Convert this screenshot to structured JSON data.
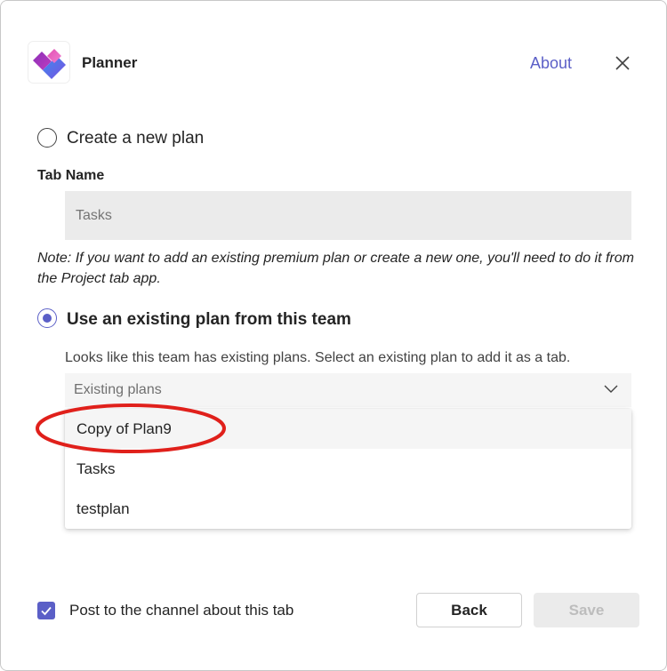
{
  "header": {
    "app_name": "Planner",
    "about_label": "About",
    "logo_icon": "planner-logo-icon",
    "close_icon": "close-icon"
  },
  "options": {
    "create_new_label": "Create a new plan",
    "create_new_selected": false,
    "use_existing_label": "Use an existing plan from this team",
    "use_existing_selected": true
  },
  "tab_name": {
    "label": "Tab Name",
    "placeholder": "Tasks",
    "value": ""
  },
  "note": "Note: If you want to add an existing premium plan or create a new one, you'll need to do it from the Project tab app.",
  "existing": {
    "helper_text": "Looks like this team has existing plans. Select an existing plan to add it as a tab.",
    "select_placeholder": "Existing plans",
    "items": [
      {
        "label": "Copy of Plan9",
        "highlighted": true
      },
      {
        "label": "Tasks",
        "highlighted": false
      },
      {
        "label": "testplan",
        "highlighted": false
      }
    ]
  },
  "footer": {
    "post_label": "Post to the channel about this tab",
    "post_checked": true,
    "back_label": "Back",
    "save_label": "Save",
    "save_disabled": true
  },
  "colors": {
    "accent": "#5b5fc7",
    "annotation": "#e0201b",
    "input_bg": "#ebebeb"
  }
}
